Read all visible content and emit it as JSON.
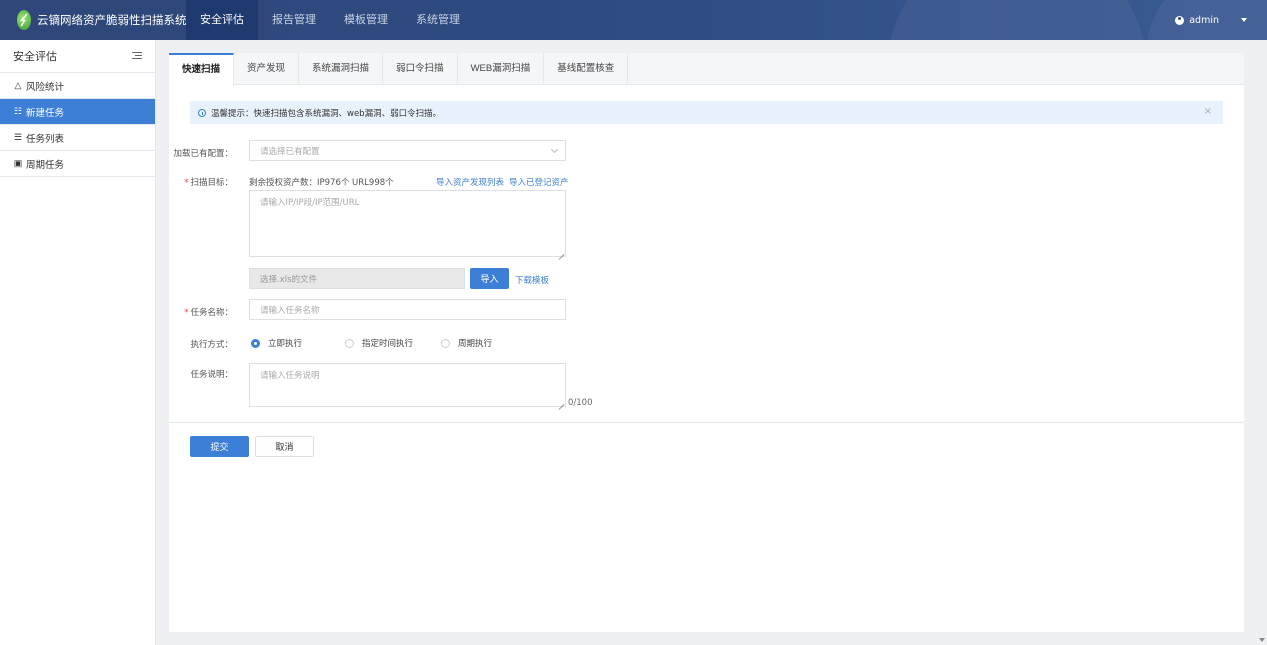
{
  "header": {
    "app_title": "云镝网络资产脆弱性扫描系统",
    "nav": [
      {
        "label": "安全评估",
        "active": true
      },
      {
        "label": "报告管理"
      },
      {
        "label": "模板管理"
      },
      {
        "label": "系统管理"
      }
    ],
    "user": "admin"
  },
  "sidebar": {
    "title": "安全评估",
    "items": [
      {
        "label": "风险统计",
        "icon": "△"
      },
      {
        "label": "新建任务",
        "icon": "☷",
        "active": true
      },
      {
        "label": "任务列表",
        "icon": "☰"
      },
      {
        "label": "周期任务",
        "icon": "▣"
      }
    ]
  },
  "tabs": [
    {
      "label": "快速扫描",
      "active": true
    },
    {
      "label": "资产发现"
    },
    {
      "label": "系统漏洞扫描"
    },
    {
      "label": "弱口令扫描"
    },
    {
      "label": "WEB漏洞扫描"
    },
    {
      "label": "基线配置核查"
    }
  ],
  "alert": {
    "text": "温馨提示：快速扫描包含系统漏洞、web漏洞、弱口令扫描。",
    "close": "×"
  },
  "form": {
    "load_config": {
      "label": "加载已有配置：",
      "placeholder": "请选择已有配置"
    },
    "scan_target": {
      "label": "扫描目标：",
      "remaining": "剩余授权资产数：IP976个 URL998个",
      "link_import_discovery": "导入资产发现列表",
      "link_import_registered": "导入已登记资产",
      "placeholder": "请输入IP/IP段/IP范围/URL"
    },
    "file": {
      "placeholder": "选择.xls的文件",
      "import_button": "导入",
      "download_link": "下载模板"
    },
    "task_name": {
      "label": "任务名称：",
      "placeholder": "请输入任务名称"
    },
    "exec_mode": {
      "label": "执行方式：",
      "options": [
        "立即执行",
        "指定时间执行",
        "周期执行"
      ],
      "selected": "立即执行"
    },
    "task_desc": {
      "label": "任务说明：",
      "placeholder": "请输入任务说明",
      "counter": "0/100"
    }
  },
  "actions": {
    "submit": "提交",
    "cancel": "取消"
  },
  "colors": {
    "primary": "#3d7fd6",
    "header": "#2d4a80",
    "required": "#e54545"
  }
}
